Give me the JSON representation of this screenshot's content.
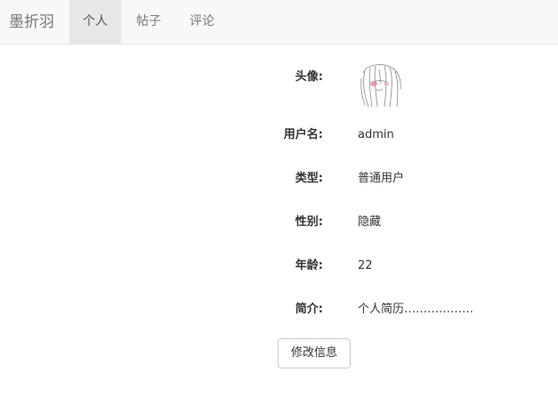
{
  "navbar": {
    "brand": "墨折羽",
    "tabs": [
      {
        "label": "个人",
        "active": true
      },
      {
        "label": "帖子",
        "active": false
      },
      {
        "label": "评论",
        "active": false
      }
    ]
  },
  "profile": {
    "avatar_label": "头像:",
    "username_label": "用户名:",
    "username": "admin",
    "type_label": "类型:",
    "type": "普通用户",
    "gender_label": "性别:",
    "gender": "隐藏",
    "age_label": "年龄:",
    "age": "22",
    "bio_label": "简介:",
    "bio": "个人简历………………"
  },
  "actions": {
    "edit_button": "修改信息"
  }
}
